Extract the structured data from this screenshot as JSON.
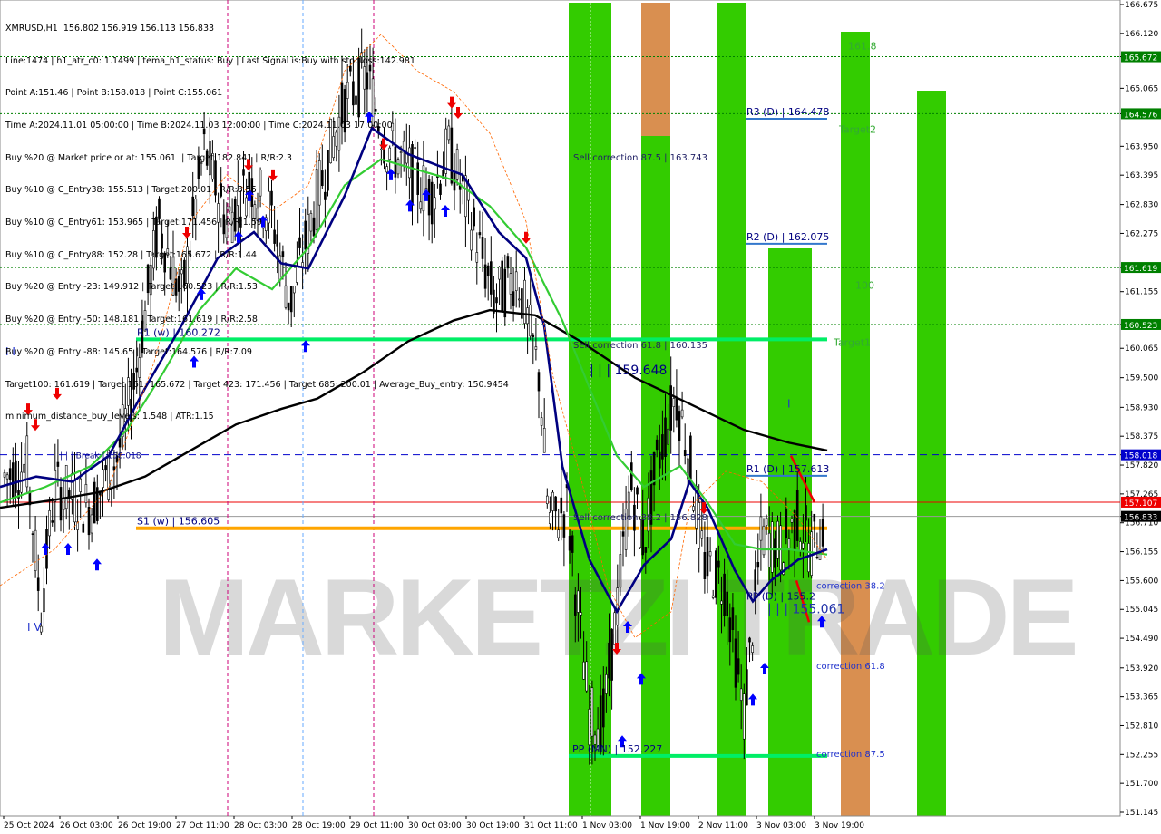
{
  "colors": {
    "bg": "#ffffff",
    "green_zone": "#33cc00",
    "orange_zone": "#d98f50",
    "ema_fast": "#000080",
    "ema_mid": "#33cc33",
    "sma_slow": "#000000",
    "level_green": "#00ee66",
    "level_orange": "#ffa500",
    "level_blue": "#0000cc",
    "price_red": "#ee0000",
    "up_arrow": "#0000ff",
    "down_arrow": "#ee0000",
    "dotted_green": "#008000"
  },
  "header_lines": [
    "XMRUSD,H1  156.802 156.919 156.113 156.833",
    "Line:1474 | h1_atr_c0: 1.1499 | tema_h1_status: Buy | Last Signal is:Buy with stoploss:142.981",
    "Point A:151.46 | Point B:158.018 | Point C:155.061",
    "Time A:2024.11.01 05:00:00 | Time B:2024.11.03 12:00:00 | Time C:2024.11.03 17:00:00",
    "Buy %20 @ Market price or at: 155.061 || Target:182.841 | R/R:2.3",
    "Buy %10 @ C_Entry38: 155.513 | Target:200.01 | R/R:3.55",
    "Buy %10 @ C_Entry61: 153.965 | Target:171.456 | R/R:1.59",
    "Buy %10 @ C_Entry88: 152.28 | Target:165.672 | R/R:1.44",
    "Buy %20 @ Entry -23: 149.912 | Target:160.523 | R/R:1.53",
    "Buy %20 @ Entry -50: 148.181 | Target:161.619 | R/R:2.58",
    "Buy %20 @ Entry -88: 145.65 | Target:164.576 | R/R:7.09",
    "Target100: 161.619 | Target 161: 165.672 | Target 423: 171.456 | Target 685: 200.01 | Average_Buy_entry: 150.9454",
    "minimum_distance_buy_levels: 1.548 | ATR:1.15"
  ],
  "chart_data": {
    "type": "candlestick",
    "symbol": "XMRUSD,H1",
    "ohlc_last": {
      "open": 156.802,
      "high": 156.919,
      "low": 156.113,
      "close": 156.833
    },
    "ylim": [
      151.145,
      166.675
    ],
    "y_ticks": [
      "166.675",
      "166.120",
      "165.672",
      "165.065",
      "164.576",
      "163.950",
      "163.395",
      "162.830",
      "162.275",
      "161.619",
      "161.155",
      "160.523",
      "160.065",
      "159.500",
      "158.930",
      "158.375",
      "158.018",
      "157.820",
      "157.265",
      "156.833",
      "156.710",
      "156.155",
      "155.600",
      "155.045",
      "154.490",
      "153.920",
      "153.365",
      "152.810",
      "152.255",
      "151.700",
      "151.145"
    ],
    "x_labels": [
      "25 Oct 2024",
      "26 Oct 03:00",
      "26 Oct 19:00",
      "27 Oct 11:00",
      "28 Oct 03:00",
      "28 Oct 19:00",
      "29 Oct 11:00",
      "30 Oct 03:00",
      "30 Oct 19:00",
      "31 Oct 11:00",
      "1 Nov 03:00",
      "1 Nov 19:00",
      "2 Nov 11:00",
      "3 Nov 03:00",
      "3 Nov 19:00"
    ],
    "price_tags": [
      {
        "value": 165.672,
        "label": "165.672",
        "color": "#008000"
      },
      {
        "value": 164.576,
        "label": "164.576",
        "color": "#008000"
      },
      {
        "value": 161.619,
        "label": "161.619",
        "color": "#008000"
      },
      {
        "value": 160.523,
        "label": "160.523",
        "color": "#008000"
      },
      {
        "value": 158.018,
        "label": "158.018",
        "color": "#0000cc"
      },
      {
        "value": 157.107,
        "label": "157.107",
        "color": "#ee0000"
      },
      {
        "value": 156.833,
        "label": "156.833",
        "color": "#000000"
      }
    ],
    "level_labels": [
      {
        "text": "R3 (D) | 164.478",
        "value": 164.478
      },
      {
        "text": "R2 (D) | 162.075",
        "value": 162.075
      },
      {
        "text": "R1 (D) | 157.613",
        "value": 157.613
      },
      {
        "text": "PP (D) | 155.2",
        "value": 155.2
      },
      {
        "text": "S1 (w) | 156.605",
        "value": 156.605
      },
      {
        "text": "R1 (w) | 160.272",
        "value": 160.272
      },
      {
        "text": "PP (MN) | 152.227",
        "value": 152.227
      },
      {
        "text": "| | | 159.648",
        "value": 159.648
      },
      {
        "text": "| | | 155.061",
        "value": 155.061
      },
      {
        "text": "Sell correction 87.5 | 163.743",
        "value": 163.743
      },
      {
        "text": "Sell correction 61.8 | 160.135",
        "value": 160.135
      },
      {
        "text": "Sell correction 38.2 | 156.828",
        "value": 156.828
      },
      {
        "text": "161.8",
        "value": 165.9
      },
      {
        "text": "Target2",
        "value": 164.3
      },
      {
        "text": "100",
        "value": 161.3
      },
      {
        "text": "Target1",
        "value": 160.2
      },
      {
        "text": "correction 38.2",
        "value": 155.513
      },
      {
        "text": "correction 61.8",
        "value": 153.965
      },
      {
        "text": "correction 87.5",
        "value": 152.28
      },
      {
        "text": "| | | Break | 158.018",
        "value": 158.018
      },
      {
        "text": "I V",
        "value": 154.7
      },
      {
        "text": "I I",
        "value": 160.0
      },
      {
        "text": "I",
        "value": 159.0
      }
    ],
    "watermark": "MARKETZI TRADE"
  }
}
